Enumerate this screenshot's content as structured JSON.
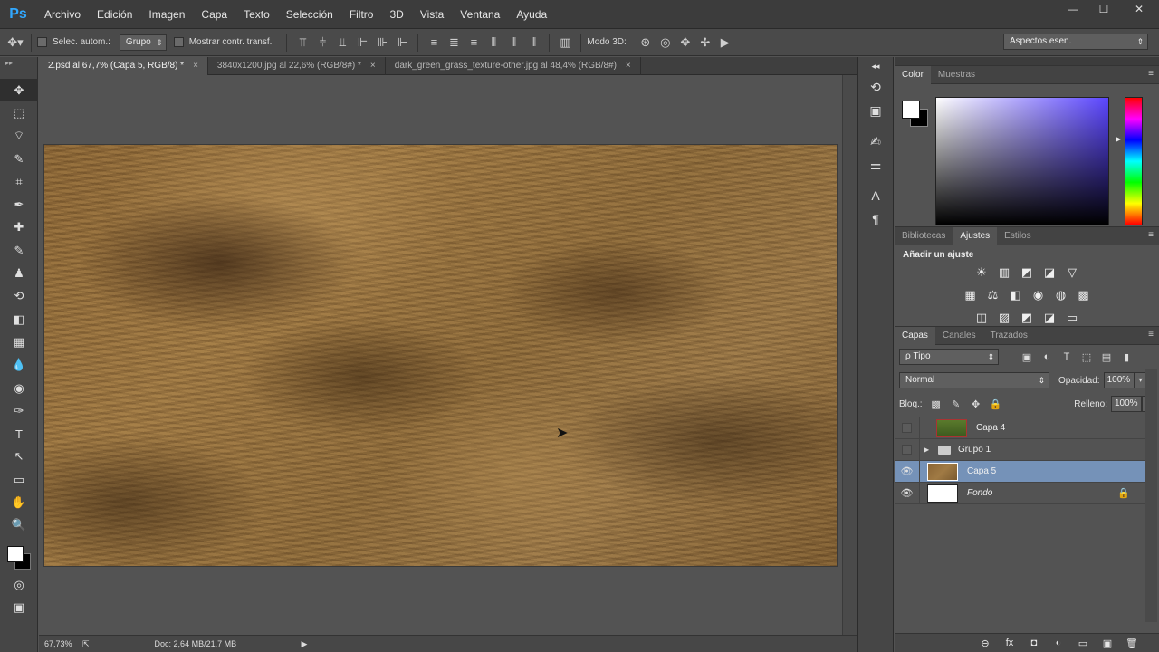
{
  "app": {
    "logo": "Ps",
    "menu": [
      "Archivo",
      "Edición",
      "Imagen",
      "Capa",
      "Texto",
      "Selección",
      "Filtro",
      "3D",
      "Vista",
      "Ventana",
      "Ayuda"
    ],
    "window_controls": {
      "minimize": "—",
      "maximize": "☐",
      "close": "✕"
    }
  },
  "options": {
    "auto_select_label": "Selec. autom.:",
    "auto_select_mode": "Grupo",
    "show_transform_label": "Mostrar contr. transf.",
    "mode3d_label": "Modo 3D:",
    "workspace": "Aspectos esen."
  },
  "tabs": [
    {
      "label": "2.psd al 67,7% (Capa 5, RGB/8) *",
      "close": "×"
    },
    {
      "label": "3840x1200.jpg al 22,6% (RGB/8#) *",
      "close": "×"
    },
    {
      "label": "dark_green_grass_texture-other.jpg al 48,4% (RGB/8#)",
      "close": "×"
    }
  ],
  "status": {
    "zoom": "67,73%",
    "doc_info": "Doc: 2,64 MB/21,7 MB",
    "arrow": "▶"
  },
  "color_panel": {
    "tabs": [
      "Color",
      "Muestras"
    ],
    "menu": "≡",
    "foreground": "#ffffff",
    "background": "#000000"
  },
  "adjust_panel": {
    "tabs": [
      "Bibliotecas",
      "Ajustes",
      "Estilos"
    ],
    "menu": "≡",
    "title": "Añadir un ajuste",
    "row1": [
      "☀",
      "▥",
      "◩",
      "◪",
      "▽"
    ],
    "row2": [
      "▦",
      "⚖",
      "◧",
      "◉",
      "◍",
      "▩"
    ],
    "row3": [
      "◫",
      "▨",
      "◩",
      "◪",
      "▭"
    ]
  },
  "layers_panel": {
    "tabs": [
      "Capas",
      "Canales",
      "Trazados"
    ],
    "menu": "≡",
    "filter": "ρ Tipo",
    "blend_mode": "Normal",
    "opacity_label": "Opacidad:",
    "opacity_value": "100%",
    "lock_label": "Bloq.:",
    "fill_label": "Relleno:",
    "fill_value": "100%",
    "layers": [
      {
        "name": "Capa 4",
        "visible": false
      },
      {
        "name": "Grupo 1",
        "visible": false
      },
      {
        "name": "Capa 5",
        "visible": true
      },
      {
        "name": "Fondo",
        "visible": true
      }
    ],
    "footer_icons": [
      "⊖",
      "fx",
      "◘",
      "◐",
      "▭",
      "▣",
      "🗑"
    ]
  },
  "tools": [
    "✥",
    "⬚",
    "⌔",
    "✎",
    "⌗",
    "✒",
    "✚",
    "✎",
    "♟",
    "⟲",
    "◧",
    "▦",
    "💧",
    "◉",
    "✑",
    "T",
    "↖",
    "▭",
    "✋",
    "🔍"
  ],
  "strip_icons": [
    "⟲",
    "▣",
    "✍",
    "⚌",
    "A",
    "¶"
  ],
  "colors": {
    "accent": "#31a8ff",
    "selection": "#7592b8"
  }
}
